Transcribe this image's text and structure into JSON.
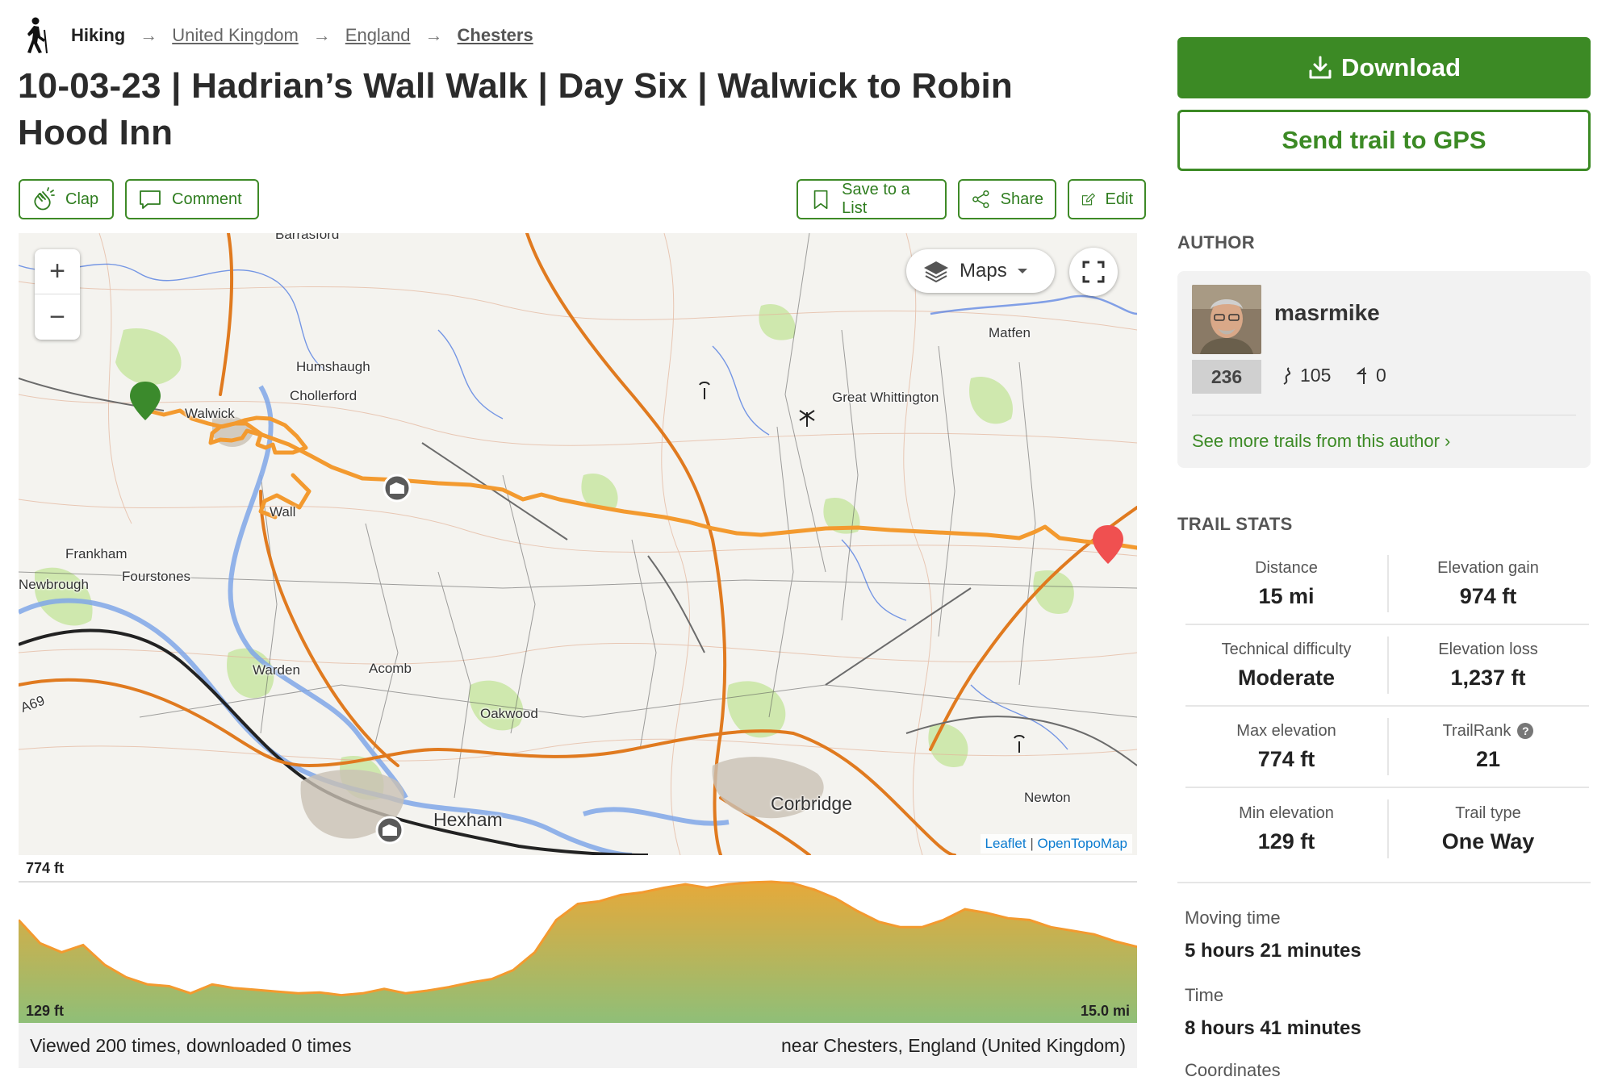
{
  "breadcrumb": {
    "activity": "Hiking",
    "items": [
      "United Kingdom",
      "England",
      "Chesters"
    ]
  },
  "title": "10-03-23 | Hadrian’s Wall Walk | Day Six | Walwick to Robin Hood Inn",
  "actions": {
    "clap": "Clap",
    "comment": "Comment",
    "save": "Save to a List",
    "share": "Share",
    "edit": "Edit"
  },
  "map": {
    "layers_label": "Maps",
    "attribution_leaflet": "Leaflet",
    "attribution_separator": "|",
    "attribution_tiles": "OpenTopoMap",
    "places": [
      "Barrasford",
      "Humshaugh",
      "Chollerford",
      "Walwick",
      "Wall",
      "Matfen",
      "Great Whittington",
      "Frankham",
      "Fourstones",
      "Newbrough",
      "Warden",
      "Acomb",
      "Oakwood",
      "Hexham",
      "Corbridge",
      "Newton",
      "A69"
    ],
    "route_color": "#f39a2f",
    "start_marker_color": "#3b8a2c",
    "end_marker_color": "#f05050"
  },
  "elevation": {
    "max_label": "774 ft",
    "min_label": "129 ft",
    "distance_label": "15.0 mi",
    "profile_ft": [
      560,
      430,
      380,
      420,
      310,
      240,
      200,
      190,
      150,
      200,
      180,
      170,
      160,
      150,
      155,
      140,
      150,
      175,
      150,
      165,
      185,
      210,
      230,
      280,
      380,
      560,
      650,
      665,
      700,
      715,
      740,
      760,
      740,
      760,
      770,
      774,
      765,
      730,
      680,
      610,
      550,
      520,
      520,
      560,
      620,
      600,
      570,
      560,
      520,
      500,
      480,
      440,
      410
    ]
  },
  "views": {
    "text": "Viewed 200 times, downloaded 0 times",
    "location": "near Chesters, England (United Kingdom)"
  },
  "sidebar": {
    "download": "Download",
    "send_gps": "Send trail to GPS",
    "author_heading": "AUTHOR",
    "author": {
      "name": "masrmike",
      "rank": "236",
      "trails": "105",
      "followers": "0",
      "more_link": "See more trails from this author ›"
    },
    "stats_heading": "TRAIL STATS",
    "stats": [
      {
        "label": "Distance",
        "value": "15 mi"
      },
      {
        "label": "Elevation gain",
        "value": "974 ft"
      },
      {
        "label": "Technical difficulty",
        "value": "Moderate"
      },
      {
        "label": "Elevation loss",
        "value": "1,237 ft"
      },
      {
        "label": "Max elevation",
        "value": "774 ft"
      },
      {
        "label": "TrailRank",
        "value": "21"
      },
      {
        "label": "Min elevation",
        "value": "129 ft"
      },
      {
        "label": "Trail type",
        "value": "One Way"
      }
    ],
    "moving_time_label": "Moving time",
    "moving_time": "5 hours 21 minutes",
    "time_label": "Time",
    "time": "8 hours 41 minutes",
    "coordinates_label": "Coordinates"
  },
  "colors": {
    "accent": "#3c8a25",
    "elevation_line": "#f39a2f"
  }
}
